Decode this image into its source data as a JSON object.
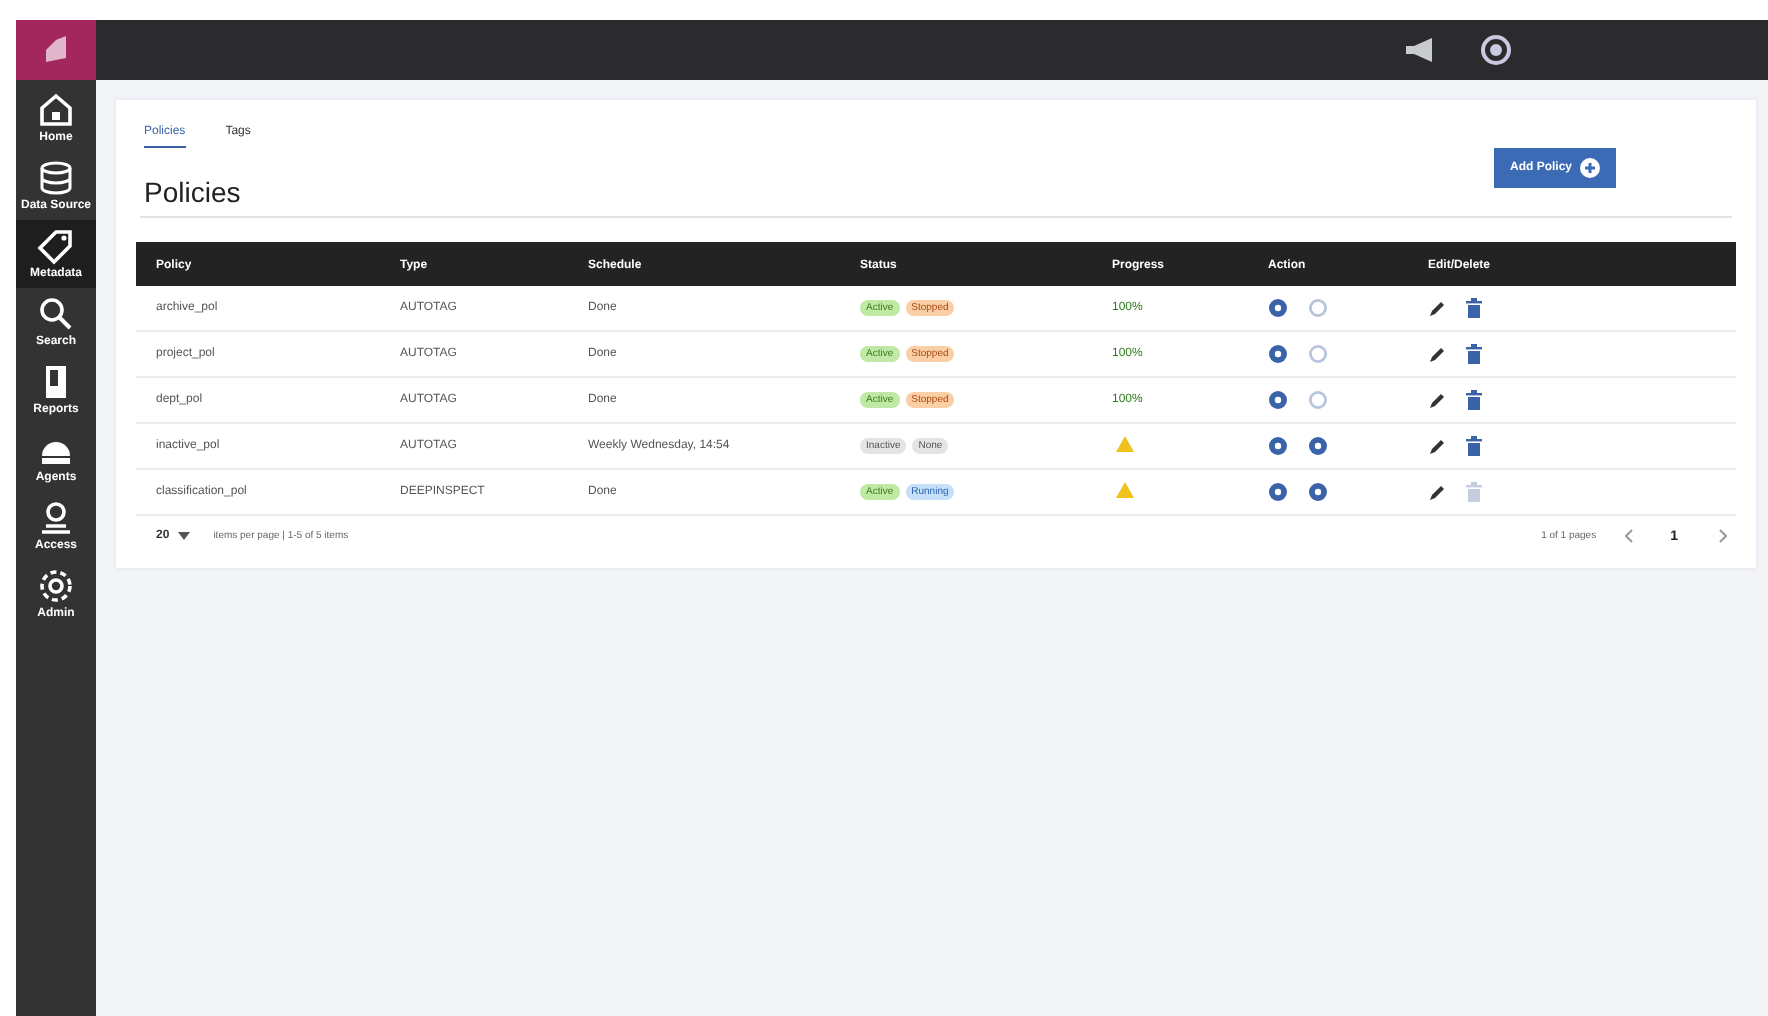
{
  "nav": [
    {
      "label": "Home",
      "kind": "home",
      "selected": false
    },
    {
      "label": "Data Source",
      "kind": "database",
      "selected": false
    },
    {
      "label": "Metadata",
      "kind": "tag",
      "selected": true
    },
    {
      "label": "Search",
      "kind": "search",
      "selected": false
    },
    {
      "label": "Reports",
      "kind": "report",
      "selected": false
    },
    {
      "label": "Agents",
      "kind": "agent",
      "selected": false
    },
    {
      "label": "Access",
      "kind": "user",
      "selected": false
    },
    {
      "label": "Admin",
      "kind": "gear",
      "selected": false
    }
  ],
  "tabs": [
    {
      "label": "Policies",
      "selected": true
    },
    {
      "label": "Tags",
      "selected": false
    }
  ],
  "heading": "Policies",
  "add_button": "Add Policy",
  "table": {
    "columns": [
      "Policy",
      "Type",
      "Schedule",
      "Status",
      "Progress",
      "Action",
      "Edit/Delete"
    ],
    "rows": [
      {
        "policy": "archive_pol",
        "type": "AUTOTAG",
        "schedule": "Done",
        "status": [
          {
            "label": "Active",
            "kind": "active"
          },
          {
            "label": "Stopped",
            "kind": "stopped"
          }
        ],
        "progress": {
          "kind": "text",
          "text": "100%"
        },
        "actions": [
          {
            "enabled": true
          },
          {
            "enabled": false
          }
        ],
        "delete_enabled": true
      },
      {
        "policy": "project_pol",
        "type": "AUTOTAG",
        "schedule": "Done",
        "status": [
          {
            "label": "Active",
            "kind": "active"
          },
          {
            "label": "Stopped",
            "kind": "stopped"
          }
        ],
        "progress": {
          "kind": "text",
          "text": "100%"
        },
        "actions": [
          {
            "enabled": true
          },
          {
            "enabled": false
          }
        ],
        "delete_enabled": true
      },
      {
        "policy": "dept_pol",
        "type": "AUTOTAG",
        "schedule": "Done",
        "status": [
          {
            "label": "Active",
            "kind": "active"
          },
          {
            "label": "Stopped",
            "kind": "stopped"
          }
        ],
        "progress": {
          "kind": "text",
          "text": "100%"
        },
        "actions": [
          {
            "enabled": true
          },
          {
            "enabled": false
          }
        ],
        "delete_enabled": true
      },
      {
        "policy": "inactive_pol",
        "type": "AUTOTAG",
        "schedule": "Weekly Wednesday, 14:54",
        "status": [
          {
            "label": "Inactive",
            "kind": "inactive"
          },
          {
            "label": "None",
            "kind": "none"
          }
        ],
        "progress": {
          "kind": "warning"
        },
        "actions": [
          {
            "enabled": true
          },
          {
            "enabled": true
          }
        ],
        "delete_enabled": true
      },
      {
        "policy": "classification_pol",
        "type": "DEEPINSPECT",
        "schedule": "Done",
        "status": [
          {
            "label": "Active",
            "kind": "active"
          },
          {
            "label": "Running",
            "kind": "running"
          }
        ],
        "progress": {
          "kind": "warning"
        },
        "actions": [
          {
            "enabled": true
          },
          {
            "enabled": true
          }
        ],
        "delete_enabled": false
      }
    ]
  },
  "pagination": {
    "page_size": "20",
    "range": "items per page | 1-5 of 5 items",
    "pages": "1 of 1 pages",
    "current": "1"
  }
}
